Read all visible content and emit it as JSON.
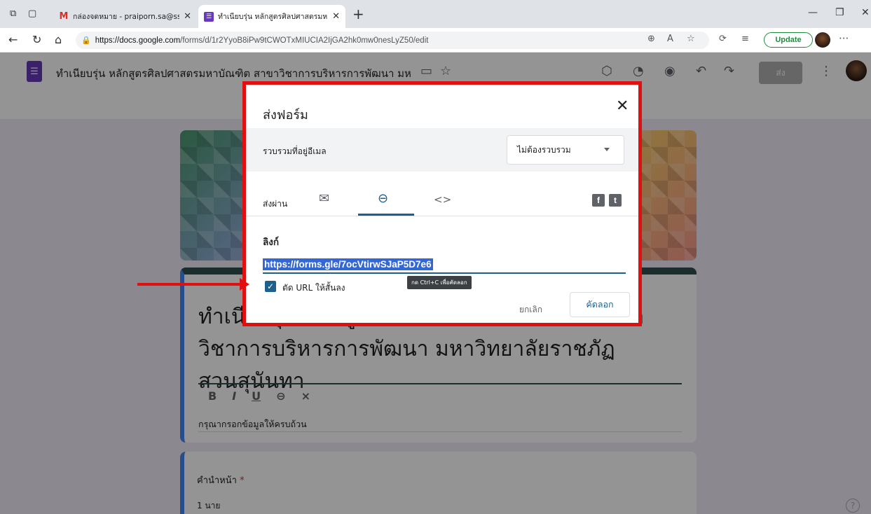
{
  "browser": {
    "tabs": [
      {
        "favicon": "M",
        "title": "กล่องจดหมาย - praiporn.sa@ssru.ac"
      },
      {
        "favicon": "☰",
        "title": "ทำเนียบรุ่น หลักสูตรศิลปศาสตรมหาบัณ"
      }
    ],
    "new_tab": "+",
    "url_host": "https://docs.google.com",
    "url_path": "/forms/d/1r2YyoB8iPw9tCWOTxMIUCIA2IjGA2hk0mw0nesLyZ50/edit",
    "update_label": "Update",
    "more": "···"
  },
  "forms_header": {
    "title": "ทำเนียบรุ่น หลักสูตรศิลปศาสตรมหาบัณฑิต สาขาวิชาการบริหารการพัฒนา มห",
    "send_label": "ส่ง"
  },
  "form": {
    "title": "ทำเนียบรุ่น หลักสูตรศิลปศาสตรมหาบัณฑิต สาขาวิชาการบริหารการพัฒนา มหาวิทยาลัยราชภัฏสวนสุนันทา",
    "description": "กรุณากรอกข้อมูลให้ครบถ้วน",
    "question_label": "คำนำหน้า",
    "required_mark": "*",
    "option_1": "1  นาย"
  },
  "dialog": {
    "title": "ส่งฟอร์ม",
    "collect_label": "รวบรวมที่อยู่อีเมล",
    "collect_value": "ไม่ต้องรวบรวม",
    "send_via_label": "ส่งผ่าน",
    "link_heading": "ลิงก์",
    "link_url": "https://forms.gle/7ocVtirwSJaP5D7e6",
    "shorten_label": "ตัด URL ให้สั้นลง",
    "tooltip": "กด Ctrl+C เพื่อคัดลอก",
    "cancel_label": "ยกเลิก",
    "copy_label": "คัดลอก"
  },
  "icons": {
    "close": "✕",
    "mail": "✉",
    "link": "⊖",
    "embed": "<>",
    "facebook": "f",
    "twitter": "t",
    "check": "✓",
    "help": "?"
  },
  "colors": {
    "accent": "#1f5f8b",
    "highlight": "#e01010",
    "forms_brand": "#673ab7"
  }
}
